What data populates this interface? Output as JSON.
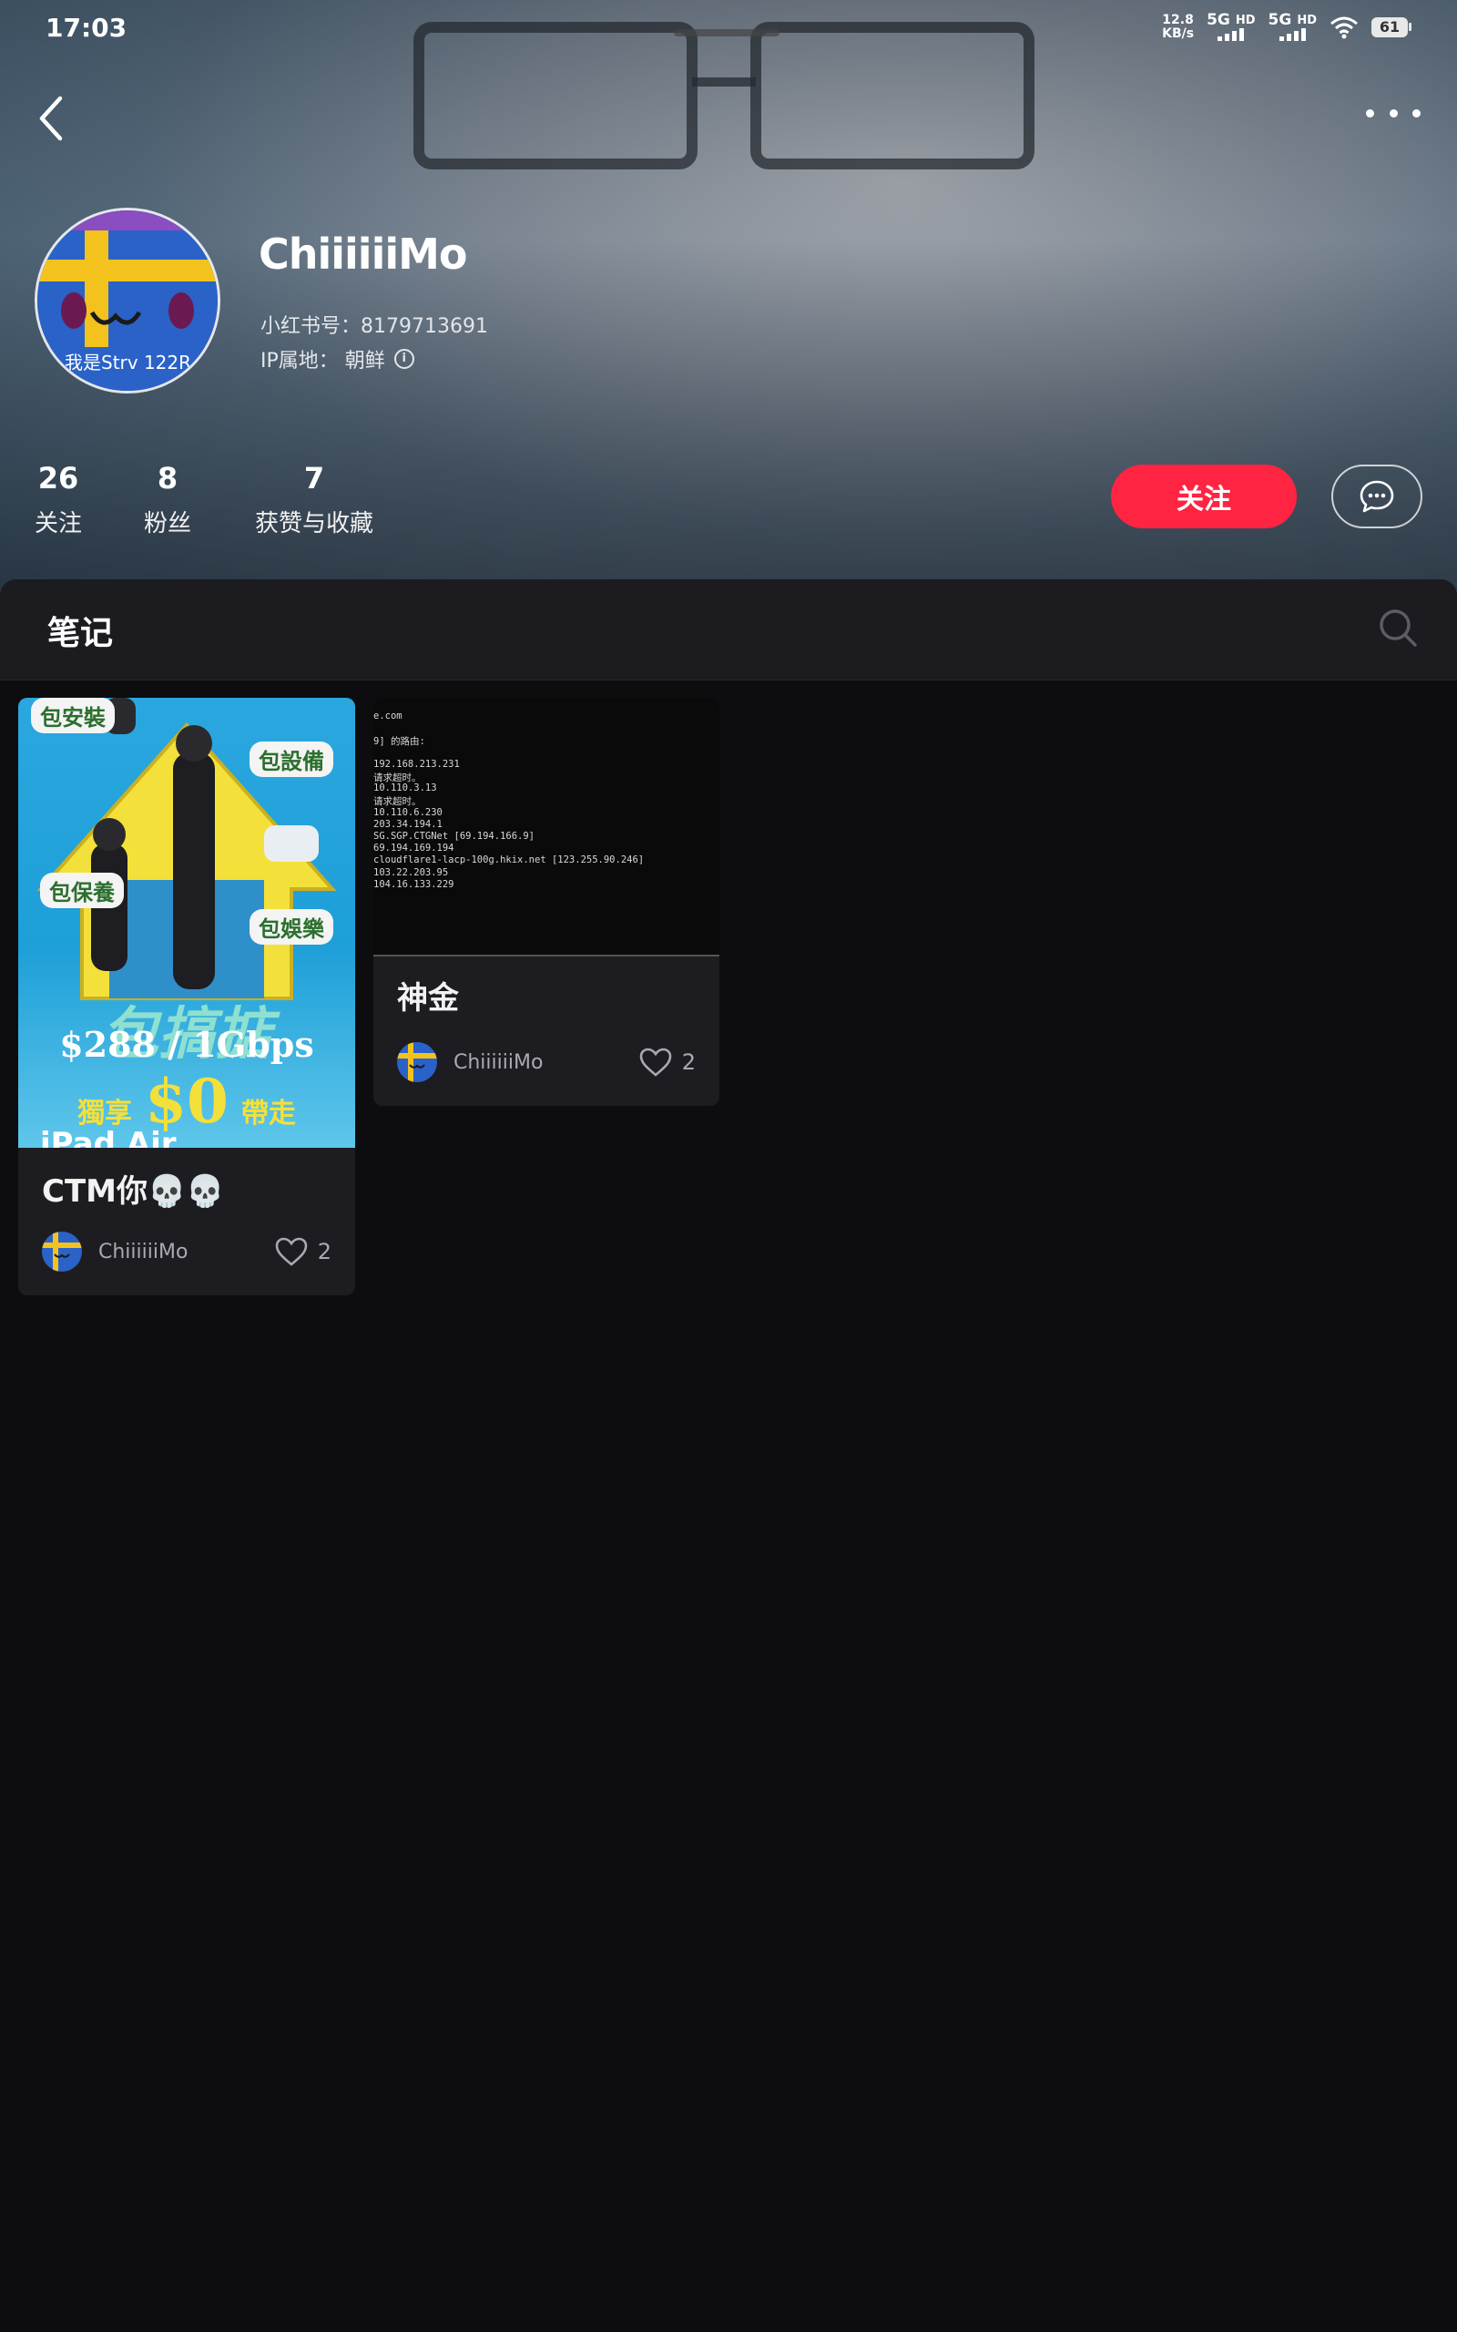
{
  "status_bar": {
    "time": "17:03",
    "speed_value": "12.8",
    "speed_unit": "KB/s",
    "sim1_type": "5G",
    "sim1_hd": "HD",
    "sim2_type": "5G",
    "sim2_hd": "HD",
    "battery": "61"
  },
  "profile": {
    "username": "ChiiiiiiMo",
    "red_id": "小红书号：8179713691",
    "ip_location": "IP属地： 朝鲜",
    "avatar_caption": "我是Strv 122R",
    "stats": [
      {
        "value": "26",
        "label": "关注"
      },
      {
        "value": "8",
        "label": "粉丝"
      },
      {
        "value": "7",
        "label": "获赞与收藏"
      }
    ],
    "follow_label": "关注"
  },
  "notes_tab": {
    "title": "笔记"
  },
  "notes": [
    {
      "title": "CTM你💀💀",
      "author": "ChiiiiiiMo",
      "likes": "2",
      "image_text": {
        "bubbles": [
          "包安裝",
          "包設備",
          "包保養",
          "包娛樂"
        ],
        "headline": "包搞掂",
        "price": "$288 / 1Gbps",
        "offer_left": "獨享",
        "offer_price": "$0",
        "offer_right": "帶走",
        "bottom": "iPad Air"
      }
    },
    {
      "title": "神金",
      "author": "ChiiiiiiMo",
      "likes": "2",
      "image_text": {
        "lines": [
          "e.com",
          "",
          "9] 的路由:",
          "",
          "192.168.213.231",
          "请求超时。",
          "10.110.3.13",
          "请求超时。",
          "10.110.6.230",
          "203.34.194.1",
          "SG.SGP.CTGNet [69.194.166.9]",
          "69.194.169.194",
          "cloudflare1-lacp-100g.hkix.net [123.255.90.246]",
          "103.22.203.95",
          "104.16.133.229"
        ]
      }
    }
  ],
  "colors": {
    "accent": "#ff2442",
    "sheet_bg": "#0d0d0f",
    "card_bg": "#1c1c21",
    "tab_bg": "#1b1b20"
  }
}
